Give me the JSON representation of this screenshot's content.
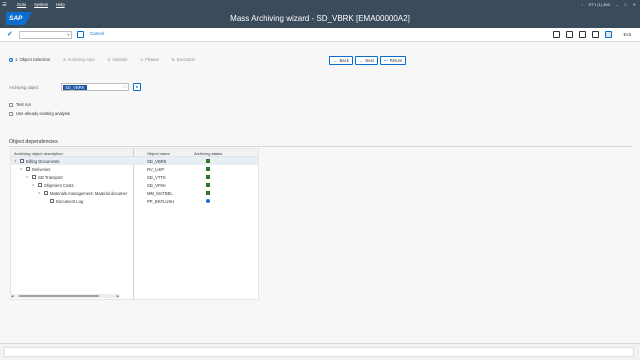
{
  "menubar": {
    "items": [
      "Goto",
      "System",
      "Help"
    ],
    "status_text": "ET1 (1) 800"
  },
  "titlebar": {
    "logo": "SAP",
    "title": "Mass Archiving wizard - SD_VBRK [EMA00000A2]"
  },
  "toolbar": {
    "command_field": "",
    "cancel_label": "Cancel",
    "exit_label": "Exit"
  },
  "steps": [
    {
      "label": "1. Object Selection",
      "active": true
    },
    {
      "label": "2. Archiving Area",
      "active": false
    },
    {
      "label": "3. Variants",
      "active": false
    },
    {
      "label": "4. Phases",
      "active": false
    },
    {
      "label": "5. Execution",
      "active": false
    }
  ],
  "nav": {
    "back": "Back",
    "next": "Next",
    "return": "Return"
  },
  "archiving_object": {
    "label": "Archiving object",
    "value": "SD_VBRK"
  },
  "checkboxes": {
    "test_run": "Test run",
    "use_existing": "Use already existing analysis"
  },
  "dependencies": {
    "section_title": "Object dependencies",
    "columns": {
      "description": "Archiving object description",
      "object_name": "Object name",
      "status": "Archiving status"
    },
    "rows": [
      {
        "desc": "Billing Documents",
        "obj": "SD_VBRK",
        "status": "green-square"
      },
      {
        "desc": "Deliveries",
        "obj": "RV_LIKP",
        "status": "green-square"
      },
      {
        "desc": "SD Transport",
        "obj": "SD_VTTK",
        "status": "green-square"
      },
      {
        "desc": "Shipment Costs",
        "obj": "SD_VFKK",
        "status": "green-square"
      },
      {
        "desc": "Materials management: Material documer",
        "obj": "MM_MATBEL",
        "status": "green-square"
      },
      {
        "desc": "Document Log",
        "obj": "PP_BKFLUSH",
        "status": "blue-circle"
      }
    ]
  },
  "colors": {
    "shell": "#3a4b5c",
    "accent": "#0a6ed1",
    "status_green": "#2b7d2b"
  }
}
